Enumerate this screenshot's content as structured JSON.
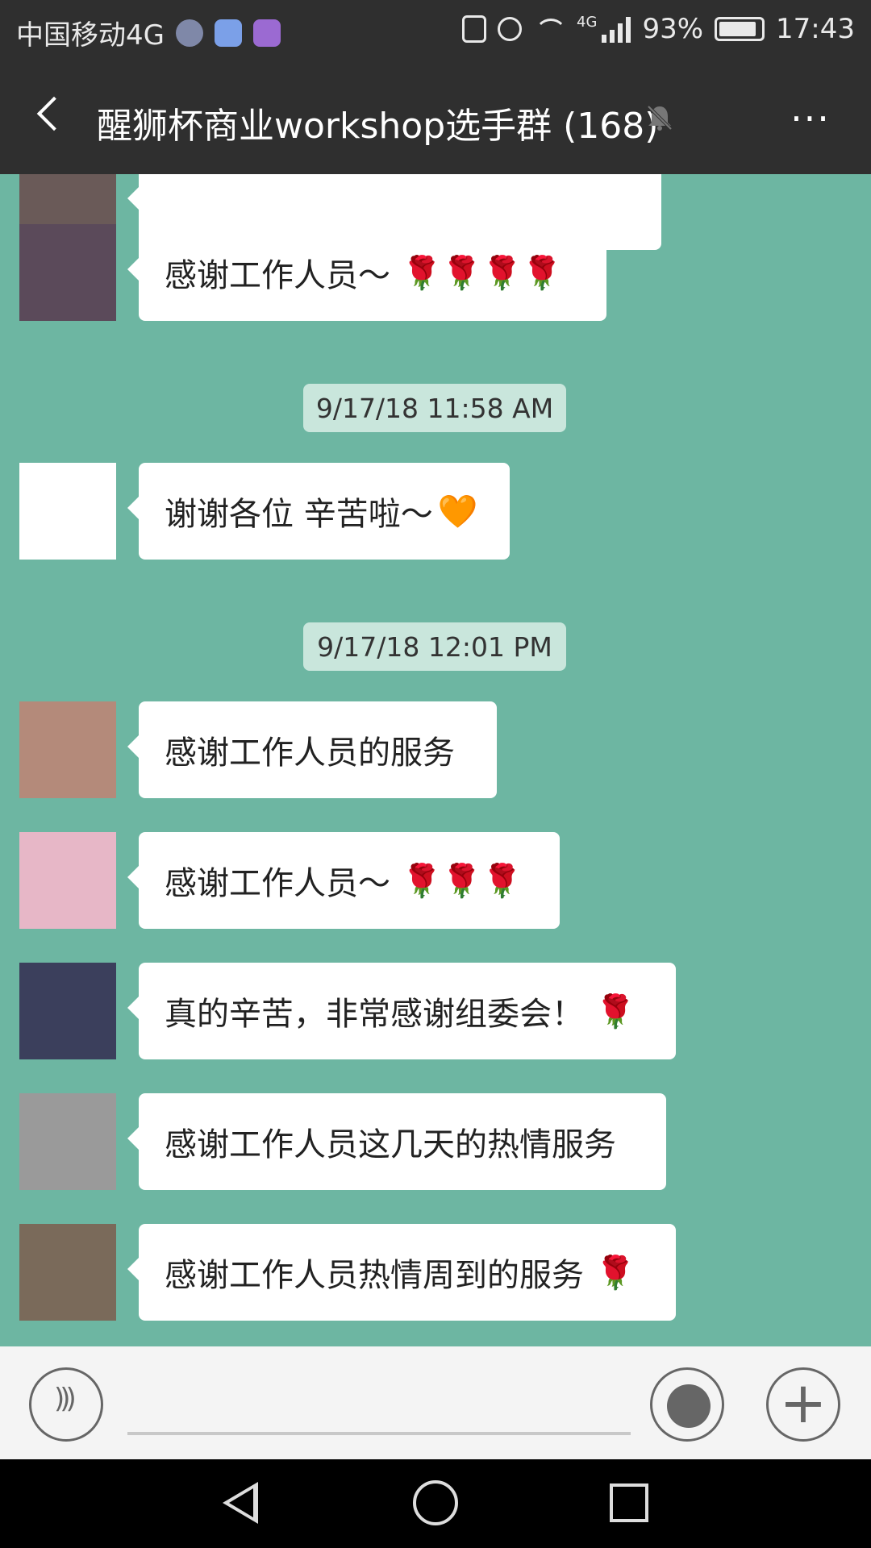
{
  "status_bar": {
    "carrier": "中国移动4G",
    "network_badge": "4G",
    "battery": "93%",
    "time": "17:43",
    "icons": [
      "alarm-app-icon",
      "message-app-icon",
      "gallery-app-icon",
      "vibrate-icon",
      "alarm-clock-icon",
      "wifi-icon",
      "signal-icon",
      "battery-icon"
    ]
  },
  "header": {
    "title": "醒狮杯商业workshop选手群 (168)",
    "more": "···"
  },
  "messages": [
    {
      "text": "感谢工作人员～",
      "emoji": "🌹🌹🌹🌹",
      "avatar_color": "#5b4a5a"
    },
    {
      "text": "谢谢各位 辛苦啦～",
      "emoji": "🧡",
      "avatar_color": "#ffffff"
    },
    {
      "text": "感谢工作人员的服务",
      "emoji": "",
      "avatar_color": "#b48a7a"
    },
    {
      "text": "感谢工作人员～",
      "emoji": "🌹🌹🌹",
      "avatar_color": "#e7b7c7"
    },
    {
      "text": "真的辛苦，非常感谢组委会！",
      "emoji": "🌹",
      "avatar_color": "#3b3f5c"
    },
    {
      "text": "感谢工作人员这几天的热情服务",
      "emoji": "",
      "avatar_color": "#9a9a9a"
    },
    {
      "text": "感谢工作人员热情周到的服务",
      "emoji": "🌹",
      "avatar_color": "#7a6a5a"
    }
  ],
  "timestamps": [
    "9/17/18 11:58 AM",
    "9/17/18 12:01 PM"
  ],
  "colors": {
    "chat_background": "#6db6a2",
    "header_background": "#2f2f2f",
    "timestamp_background": "#c9e6dc"
  }
}
